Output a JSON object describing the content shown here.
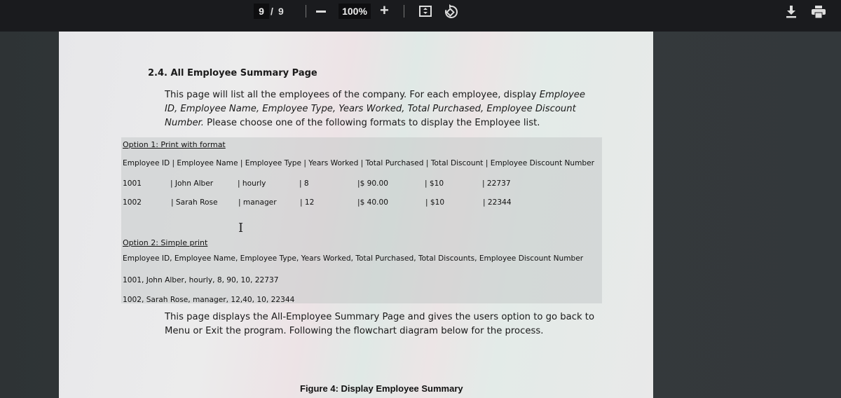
{
  "toolbar": {
    "current_page": "9",
    "page_separator": "/",
    "total_pages": "9",
    "zoom_level": "100%",
    "zoom_in_label": "+",
    "icons": {
      "zoom_out": "minus-icon",
      "zoom_in": "plus-icon",
      "fit": "fit-to-page-icon",
      "rotate": "rotate-icon",
      "download": "download-icon",
      "print": "print-icon"
    }
  },
  "document": {
    "section_title": "2.4. All Employee Summary Page",
    "intro": {
      "part1": "This page will list all the employees of the company. For each employee, display ",
      "fields_italic": "Employee ID, Employee Name, Employee Type, Years Worked, Total Purchased, Employee Discount Number.",
      "part2": " Please choose one of the following formats to display the Employee list."
    },
    "option1": {
      "title": "Option 1: Print with format",
      "header": "Employee ID | Employee Name | Employee Type | Years Worked | Total Purchased | Total Discount | Employee Discount Number",
      "rows": [
        [
          "1001",
          "| John Alber",
          "| hourly",
          "| 8",
          "|$ 90.00",
          "| $10",
          "| 22737"
        ],
        [
          "1002",
          "| Sarah Rose",
          "| manager",
          "| 12",
          "|$ 40.00",
          "| $10",
          "| 22344"
        ]
      ]
    },
    "option2": {
      "title": "Option 2: Simple print",
      "header": "Employee ID, Employee Name, Employee Type, Years Worked, Total Purchased, Total Discounts, Employee Discount Number",
      "lines": [
        "1001, John Alber, hourly, 8, 90, 10, 22737",
        "1002, Sarah Rose, manager, 12,40, 10, 22344"
      ]
    },
    "outro": "This page displays the All-Employee Summary Page and gives the users option to go back to Menu or Exit the program.  Following the flowchart diagram below for the process.",
    "figure_caption": "Figure 4: Display Employee Summary",
    "cursor_glyph": "I"
  }
}
